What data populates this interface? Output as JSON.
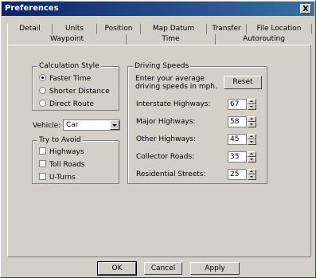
{
  "window": {
    "title": "Preferences",
    "close_label": "X"
  },
  "tabs_row1": [
    "Detail",
    "Units",
    "Position",
    "Map Datum",
    "Transfer",
    "File Location"
  ],
  "tabs_row2": [
    "Waypoint",
    "Time",
    "Autorouting"
  ],
  "calc_style": {
    "title": "Calculation Style",
    "options": [
      "Faster Time",
      "Shorter Distance",
      "Direct Route"
    ],
    "selected": "Faster Time"
  },
  "vehicle": {
    "label": "Vehicle:",
    "value": "Car"
  },
  "avoid": {
    "title": "Try to Avoid",
    "items": [
      "Highways",
      "Toll Roads",
      "U-Turns"
    ]
  },
  "driving_speeds": {
    "title": "Driving Speeds",
    "instructions": "Enter your average driving speeds in mph.",
    "reset_label": "Reset",
    "rows": [
      {
        "label": "Interstate Highways:",
        "value": "67"
      },
      {
        "label": "Major Highways:",
        "value": "58"
      },
      {
        "label": "Other Highways:",
        "value": "45"
      },
      {
        "label": "Collector Roads:",
        "value": "35"
      },
      {
        "label": "Residential Streets:",
        "value": "25"
      }
    ]
  },
  "buttons": {
    "ok": "OK",
    "cancel": "Cancel",
    "apply": "Apply"
  }
}
